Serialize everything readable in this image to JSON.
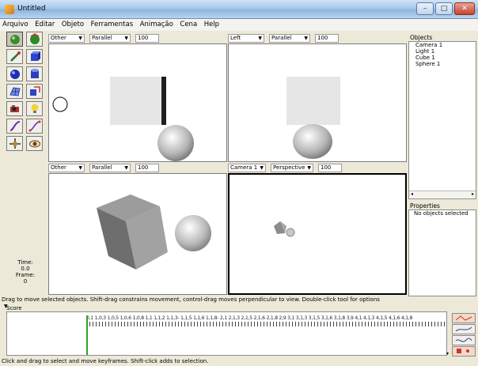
{
  "window": {
    "title": "Untitled",
    "minimize": "–",
    "maximize": "□",
    "close": "✕"
  },
  "menu": [
    "Arquivo",
    "Editar",
    "Objeto",
    "Ferramentas",
    "Animação",
    "Cena",
    "Help"
  ],
  "toolbox": {
    "tools": [
      "move-tool-icon",
      "rotate-tool-icon",
      "pen-tool-icon",
      "cube-tool-icon",
      "sphere-tool-icon",
      "cylinder-tool-icon",
      "mesh-tool-icon",
      "scale-tool-icon",
      "camera-tool-icon",
      "light-tool-icon",
      "curve-tool-icon",
      "spline-tool-icon",
      "pan-view-icon",
      "eye-view-icon"
    ]
  },
  "time_panel": {
    "time_label": "Time:",
    "time_value": "0.0",
    "frame_label": "Frame:",
    "frame_value": "0"
  },
  "viewports": {
    "top_left": {
      "view": "Other",
      "projection": "Parallel",
      "scale": "100"
    },
    "top_right": {
      "view": "Left",
      "projection": "Parallel",
      "scale": "100"
    },
    "bottom_left": {
      "view": "Other",
      "projection": "Parallel",
      "scale": "100"
    },
    "bottom_right": {
      "view": "Camera 1",
      "projection": "Perspective",
      "scale": "100"
    }
  },
  "objects_panel": {
    "title": "Objects",
    "items": [
      "Camera 1",
      "Light 1",
      "Cube 1",
      "Sphere 1"
    ]
  },
  "properties_panel": {
    "title": "Properties",
    "empty_text": "No objects selected"
  },
  "hint_text": "Drag to move selected objects.  Shift-drag constrains movement, control-drag moves perpendicular to view.  Double-click tool for options",
  "score_label": "Score",
  "timeline": {
    "ruler_labels": "0,1 1,0,3 1,0,5 1,0,6 1,0,8 1,1 1,1,2 1,1,3- 1,1,5 1,1,6 1,1,8- 2,1 2,1,3 2,1,5 2,1,6 2,1,8 2,9 3,1 3,1,3 3,1,5 3,1,6 3,1,8 3,9 4,1 4,1,3 4,1,5 4,1,6 4,1,8"
  },
  "footer_text": "Click and drag to select and move keyframes.  Shift-click adds to selection.",
  "colors": {
    "accent_green": "#2fa32f",
    "viewport_bg": "#ffffff",
    "window_bg": "#ece9d8"
  }
}
